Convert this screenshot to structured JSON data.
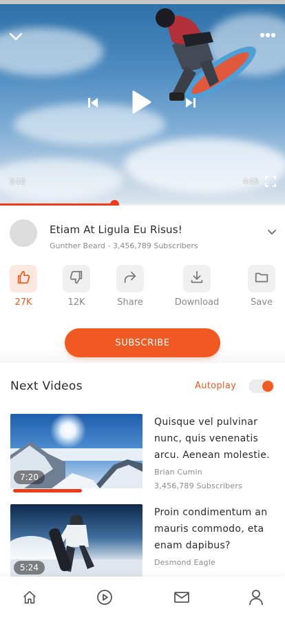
{
  "player": {
    "current_time": "2:12",
    "duration": "4:15",
    "progress_percent": 40,
    "icons": {
      "minimize": "chevron-down-icon",
      "menu": "more-horizontal-icon",
      "previous": "skip-previous-icon",
      "play": "play-icon",
      "next": "skip-next-icon",
      "fullscreen": "fullscreen-icon"
    }
  },
  "video": {
    "title": "Etiam At Ligula Eu Risus!",
    "channel": "Gunther Beard",
    "separator": " - ",
    "subscribers": "3,456,789 Subscribers"
  },
  "actions": [
    {
      "label": "27K",
      "icon": "thumbs-up-icon",
      "active": true
    },
    {
      "label": "12K",
      "icon": "thumbs-down-icon",
      "active": false
    },
    {
      "label": "Share",
      "icon": "share-icon",
      "active": false
    },
    {
      "label": "Download",
      "icon": "download-icon",
      "active": false
    },
    {
      "label": "Save",
      "icon": "folder-icon",
      "active": false
    }
  ],
  "subscribe_label": "SUBSCRIBE",
  "next": {
    "heading": "Next Videos",
    "autoplay_label": "Autoplay",
    "autoplay_on": true,
    "items": [
      {
        "title": "Quisque vel pulvinar nunc, quis venenatis arcu. Aenean molestie.",
        "author": "Brian Cumin",
        "subscribers": "3,456,789 Subscribers",
        "duration": "7:20",
        "watched_fraction": 0.52
      },
      {
        "title": "Proin condimentum an mauris commodo, eta enam dapibus?",
        "author": "Desmond Eagle",
        "subscribers": "",
        "duration": "5:24",
        "watched_fraction": 0
      }
    ]
  },
  "nav": [
    {
      "icon": "home-icon"
    },
    {
      "icon": "play-circle-icon"
    },
    {
      "icon": "mail-icon"
    },
    {
      "icon": "user-icon"
    }
  ],
  "colors": {
    "accent": "#f05a22",
    "progress": "#ee3a16",
    "text": "#2a2a2a",
    "muted": "#888888"
  }
}
